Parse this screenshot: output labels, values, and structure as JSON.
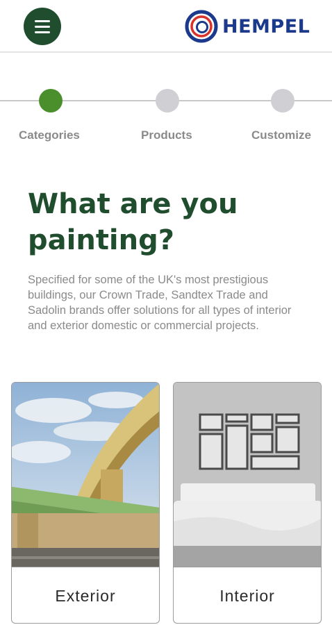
{
  "header": {
    "brand": "HEMPEL",
    "menu_icon": "hamburger-menu-icon",
    "brand_color": "#1b3a8c",
    "menu_color": "#1f4d2e"
  },
  "stepper": {
    "steps": [
      {
        "label": "Categories",
        "active": true
      },
      {
        "label": "Products",
        "active": false
      },
      {
        "label": "Customize",
        "active": false
      }
    ],
    "active_color": "#4a8f2c",
    "inactive_color": "#cfcfd4"
  },
  "main": {
    "title": "What are you painting?",
    "description": "Specified for some of the UK's most prestigious buildings, our Crown Trade, Sandtex Trade and Sadolin brands offer solutions for all types of interior and exterior domestic or commercial projects."
  },
  "categories": [
    {
      "label": "Exterior"
    },
    {
      "label": "Interior"
    }
  ]
}
